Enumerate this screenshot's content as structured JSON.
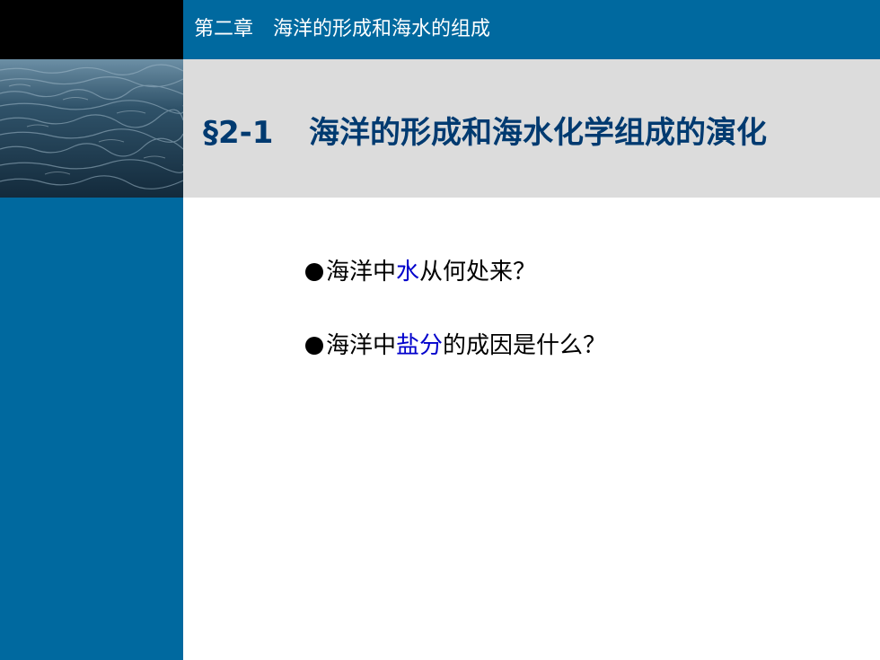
{
  "header": {
    "chapter_title": "第二章　海洋的形成和海水的组成"
  },
  "section": {
    "number": "§2-1",
    "title": "海洋的形成和海水化学组成的演化"
  },
  "bullets": [
    {
      "pre": "海洋中",
      "highlight": "水",
      "post": "从何处来",
      "q": "？"
    },
    {
      "pre": "海洋中",
      "highlight": "盐分",
      "post": "的成因是什么",
      "q": "？"
    }
  ],
  "colors": {
    "brand_blue": "#00699f",
    "band_gray": "#dcdcdc",
    "title_navy": "#003a70",
    "highlight_blue": "#0000cc"
  },
  "icons": {
    "bullet": "filled-circle-icon",
    "ocean": "ocean-waves-image"
  }
}
